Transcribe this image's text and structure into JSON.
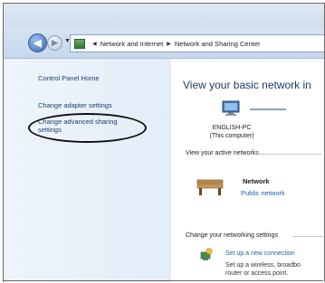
{
  "address": {
    "root_icon": "network-folder-icon",
    "crumbs": [
      "Network and Internet",
      "Network and Sharing Center"
    ]
  },
  "sidebar": {
    "items": [
      {
        "label": "Control Panel Home"
      },
      {
        "label": "Change adapter settings"
      },
      {
        "label": "Change advanced sharing settings"
      }
    ]
  },
  "main": {
    "title": "View your basic network in",
    "computer": {
      "name": "ENGLISH-PC",
      "note": "(This computer)"
    },
    "active_header": "View your active networks",
    "network": {
      "name": "Network",
      "type": "Public network"
    },
    "change_header": "Change your networking settings",
    "setup": {
      "link": "Set up a new connection",
      "desc1": "Set up a wireless, broadbo",
      "desc2": "router or access point."
    }
  },
  "colors": {
    "link": "#1f5fb0",
    "title": "#1e3a6e",
    "sidebar_text": "#1e3d6d"
  }
}
